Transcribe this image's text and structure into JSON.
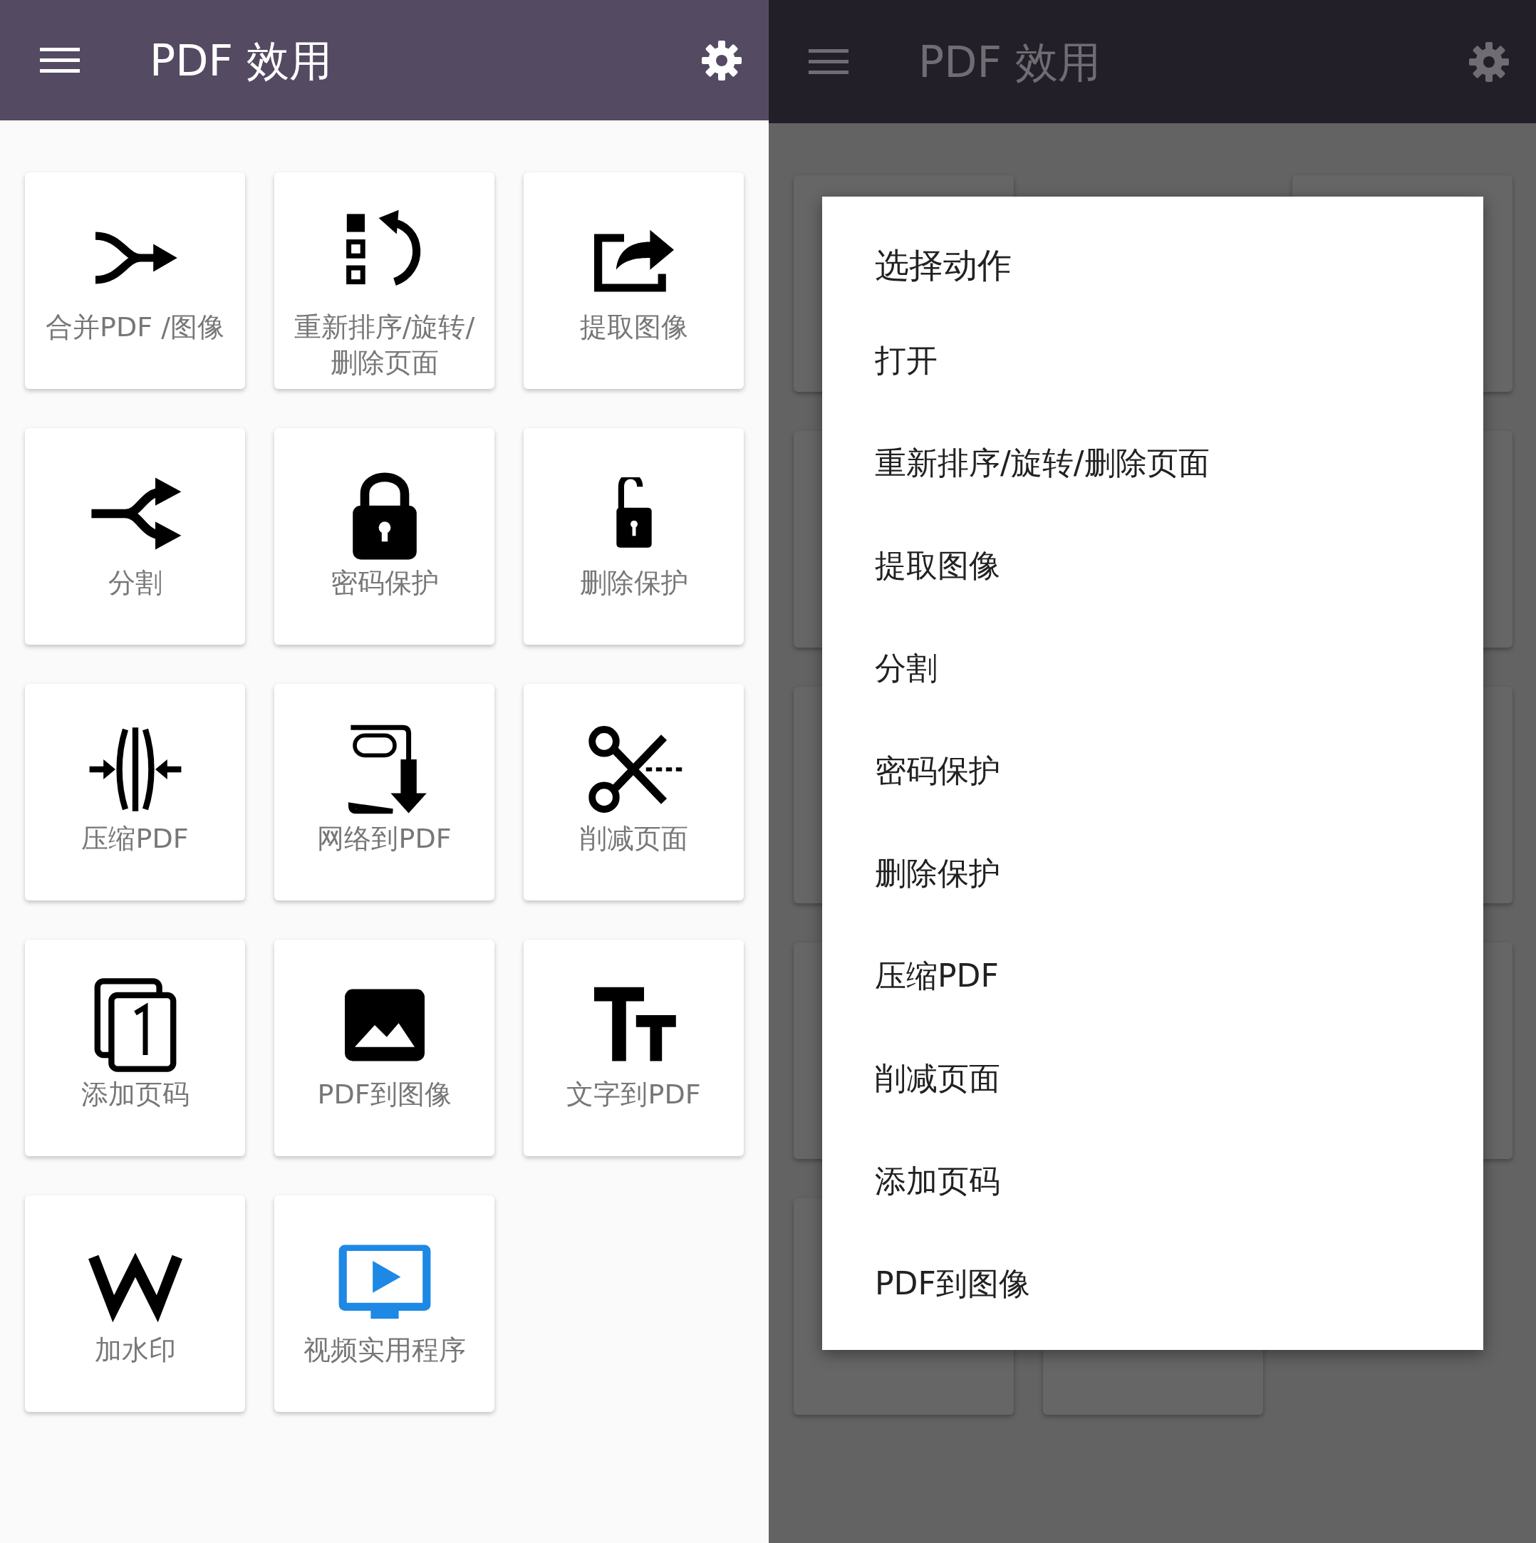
{
  "left_screen": {
    "app_bar": {
      "title": "PDF 效用"
    },
    "tools": [
      {
        "label": "合并PDF /图像",
        "kind": "merge"
      },
      {
        "label": "重新排序/旋转/删除页面",
        "kind": "reorder"
      },
      {
        "label": "提取图像",
        "kind": "extract"
      },
      {
        "label": "分割",
        "kind": "split"
      },
      {
        "label": "密码保护",
        "kind": "lock"
      },
      {
        "label": "删除保护",
        "kind": "unlock"
      },
      {
        "label": "压缩PDF",
        "kind": "compress"
      },
      {
        "label": "网络到PDF",
        "kind": "web_pdf"
      },
      {
        "label": "削减页面",
        "kind": "scissors"
      },
      {
        "label": "添加页码",
        "kind": "page_number"
      },
      {
        "label": "PDF到图像",
        "kind": "image"
      },
      {
        "label": "文字到PDF",
        "kind": "text"
      },
      {
        "label": "加水印",
        "kind": "watermark"
      },
      {
        "label": "视频实用程序",
        "kind": "video"
      }
    ]
  },
  "right_screen": {
    "app_bar": {
      "title": "PDF 效用"
    },
    "dialog": {
      "title": "选择动作",
      "options": [
        "打开",
        "重新排序/旋转/删除页面",
        "提取图像",
        "分割",
        "密码保护",
        "删除保护",
        "压缩PDF",
        "削减页面",
        "添加页码",
        "PDF到图像"
      ]
    }
  }
}
